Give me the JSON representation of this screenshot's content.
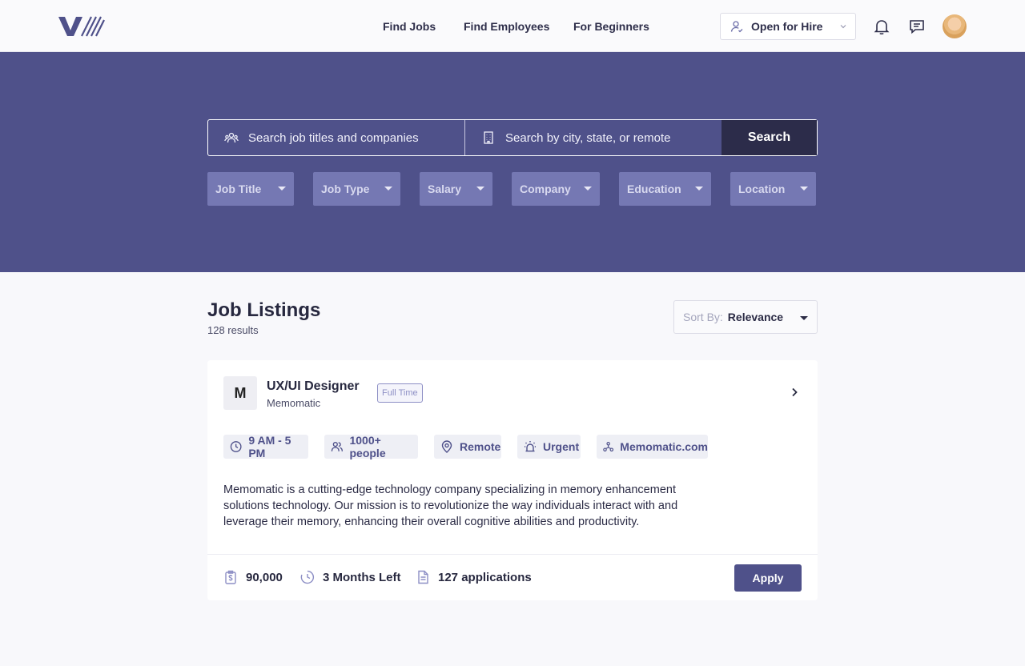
{
  "header": {
    "nav": [
      "Find Jobs",
      "Find Employees",
      "For Beginners"
    ],
    "status_select": "Open for Hire",
    "icons": [
      "bell-icon",
      "message-icon"
    ]
  },
  "search": {
    "query_placeholder": "Search job titles and companies",
    "location_placeholder": "Search by city, state, or remote",
    "button": "Search"
  },
  "filters": [
    "Job Title",
    "Job Type",
    "Salary",
    "Company",
    "Education",
    "Location"
  ],
  "listings": {
    "title": "Job Listings",
    "count": "128 results",
    "sort_label": "Sort By:",
    "sort_value": "Relevance"
  },
  "job": {
    "logo_letter": "M",
    "title": "UX/UI Designer",
    "company": "Memomatic",
    "badge": "Full Time",
    "tags": [
      "9 AM - 5 PM",
      "1000+ people",
      "Remote",
      "Urgent",
      "Memomatic.com"
    ],
    "description": "Memomatic is a cutting-edge technology company specializing in memory enhancement solutions technology. Our mission is to revolutionize the way individuals interact with and leverage their memory, enhancing their overall cognitive abilities and productivity.",
    "salary": "90,000",
    "time_left": "3 Months Left",
    "applications": "127 applications",
    "apply_button": "Apply"
  },
  "colors": {
    "primary": "#4f518a",
    "dark": "#2c2c4a",
    "filter": "#7578b3"
  }
}
